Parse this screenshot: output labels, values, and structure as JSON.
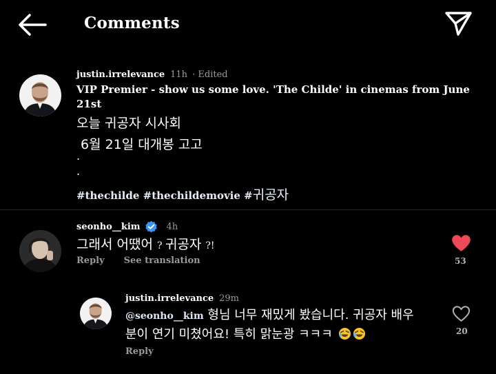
{
  "header": {
    "title": "Comments",
    "back_icon": "arrow-left-icon",
    "send_icon": "paper-plane-icon"
  },
  "caption": {
    "username": "justin.irrelevance",
    "time": "11h",
    "edited": "· Edited",
    "line1": "VIP Premier - show us some love. 'The Childe' in cinemas from June",
    "line2": "21st",
    "korean_line1": "오늘 귀공자 시사회",
    "korean_line2": "6월 21일 대개봉 고고",
    "dot1": ".",
    "dot2": ".",
    "tag1": "#thechilde",
    "tag2": "#thechildemovie",
    "tag3_prefix": "#",
    "tag3_ko": "귀공자"
  },
  "comment1": {
    "username": "seonho__kim",
    "verified_icon": "verified-badge-icon",
    "time": "4h",
    "text_ko": "그래서 어땠어 ",
    "text_mid": "? ",
    "text_ko2": "귀공자 ",
    "text_end": "?!",
    "reply_label": "Reply",
    "translate_label": "See translation",
    "likes": "53",
    "liked": true,
    "accent": "#ed4956"
  },
  "comment2": {
    "username": "justin.irrelevance",
    "time": "29m",
    "mention": "@seonho__kim",
    "text_line1": " 형님 너무 재밌게 봤습니다. 귀공자 배우",
    "text_line2": "분이 연기 미쳤어요! 특히 맑눈광 ㅋㅋㅋ ",
    "reply_label": "Reply",
    "likes": "20",
    "liked": false
  },
  "colors": {
    "background": "#000000",
    "text": "#ffffff",
    "muted": "#9a9a9a",
    "verified": "#3897f0",
    "heart_red": "#ed4956"
  }
}
